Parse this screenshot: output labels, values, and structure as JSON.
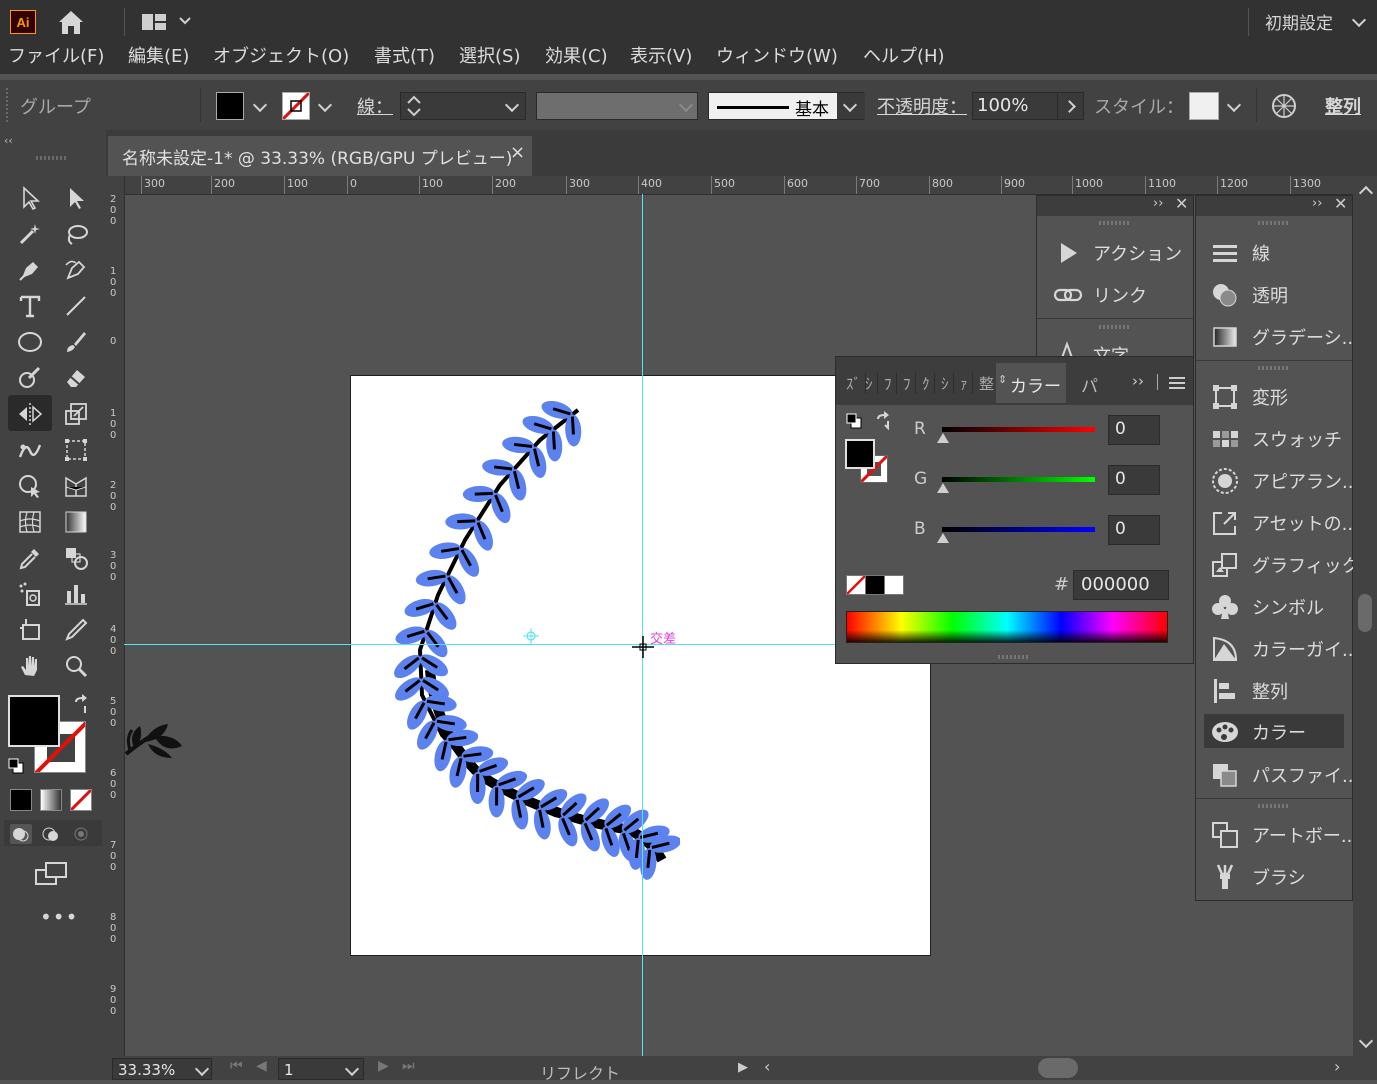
{
  "app": {
    "logo_text": "Ai",
    "workspace": "初期設定"
  },
  "menu": [
    "ファイル(F)",
    "編集(E)",
    "オブジェクト(O)",
    "書式(T)",
    "選択(S)",
    "効果(C)",
    "表示(V)",
    "ウィンドウ(W)",
    "ヘルプ(H)"
  ],
  "control": {
    "selection_type": "グループ",
    "stroke_label": "線：",
    "brush_label": "基本",
    "opacity_label": "不透明度：",
    "opacity_value": "100%",
    "style_label": "スタイル：",
    "align_label": "整列"
  },
  "document": {
    "tab_title": "名称未設定-1* @ 33.33% (RGB/GPU プレビュー)",
    "close": "×"
  },
  "ruler": {
    "h": [
      "300",
      "200",
      "100",
      "0",
      "100",
      "200",
      "300",
      "400",
      "500",
      "600",
      "700",
      "800",
      "900",
      "1000",
      "1100",
      "1200",
      "1300"
    ],
    "v": [
      "200",
      "100",
      "0",
      "100",
      "200",
      "300",
      "400",
      "500",
      "600",
      "700",
      "800",
      "900"
    ]
  },
  "canvas": {
    "smart_guide_label": "交差"
  },
  "panel_left": {
    "items": [
      {
        "label": "アクション",
        "icon": "play-icon"
      },
      {
        "label": "リンク",
        "icon": "link-icon"
      },
      {
        "label": "文字",
        "icon": "type-icon"
      }
    ]
  },
  "color_panel": {
    "tabs": [
      "ｽﾞ",
      "ｼ",
      "ﾌ",
      "ﾌ",
      "ｸ",
      "ｼ",
      "ｧ",
      "整"
    ],
    "active_tab": "カラー",
    "next_tab": "パ",
    "sliders": [
      {
        "name": "R",
        "value": "0"
      },
      {
        "name": "G",
        "value": "0"
      },
      {
        "name": "B",
        "value": "0"
      }
    ],
    "hex_label": "#",
    "hex_value": "000000"
  },
  "panel_right": {
    "groups": [
      [
        {
          "label": "線",
          "icon": "stroke-icon"
        },
        {
          "label": "透明",
          "icon": "transparency-icon"
        },
        {
          "label": "グラデーシ...",
          "icon": "gradient-icon"
        }
      ],
      [
        {
          "label": "変形",
          "icon": "transform-icon"
        },
        {
          "label": "スウォッチ",
          "icon": "swatches-icon"
        },
        {
          "label": "アピアラン...",
          "icon": "appearance-icon"
        },
        {
          "label": "アセットの...",
          "icon": "asset-export-icon"
        },
        {
          "label": "グラフィック...",
          "icon": "graphic-styles-icon"
        },
        {
          "label": "シンボル",
          "icon": "symbols-icon"
        },
        {
          "label": "カラーガイ...",
          "icon": "color-guide-icon"
        },
        {
          "label": "整列",
          "icon": "align-icon"
        },
        {
          "label": "カラー",
          "icon": "color-icon"
        },
        {
          "label": "パスファイ...",
          "icon": "pathfinder-icon"
        }
      ],
      [
        {
          "label": "アートボー...",
          "icon": "artboards-icon"
        },
        {
          "label": "ブラシ",
          "icon": "brushes-icon"
        }
      ]
    ]
  },
  "status": {
    "zoom": "33.33%",
    "artboard": "1",
    "tool": "リフレクト"
  },
  "colors": {
    "leaf": "#5b82ee",
    "guide": "#55e5f2",
    "smart_guide": "#e040e0"
  }
}
